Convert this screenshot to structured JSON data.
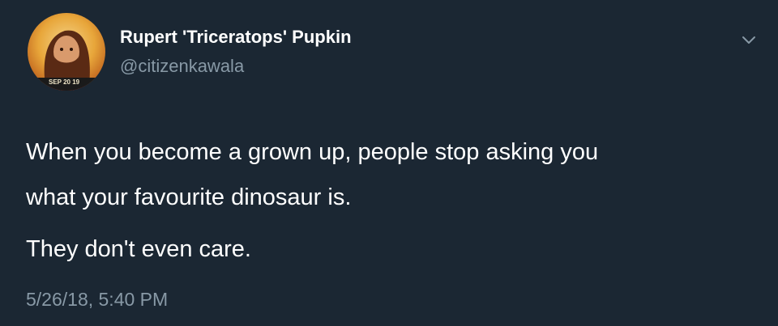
{
  "tweet": {
    "author": {
      "display_name": "Rupert 'Triceratops' Pupkin",
      "handle": "@citizenkawala",
      "avatar_stamp": "SEP 20 19"
    },
    "text_lines": [
      "When you become a grown up, people stop asking you",
      "what your favourite dinosaur is.",
      "They don't even care."
    ],
    "timestamp": "5/26/18, 5:40 PM",
    "menu_icon": "chevron-down-icon"
  },
  "colors": {
    "background": "#1b2733",
    "primary_text": "#ffffff",
    "secondary_text": "#8899a6"
  }
}
